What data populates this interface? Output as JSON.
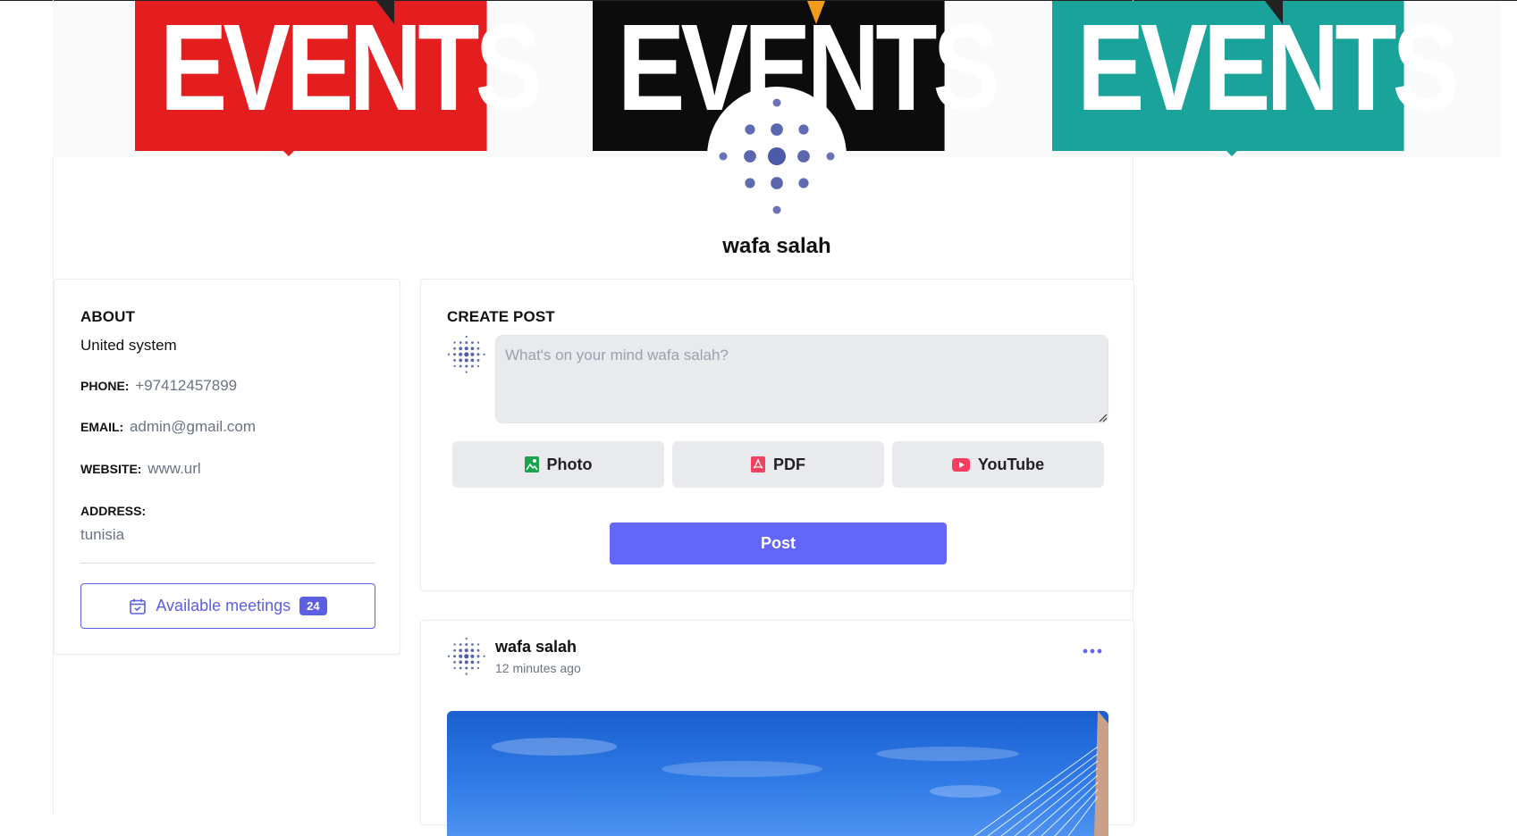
{
  "banner": {
    "words": [
      "EVENTS",
      "EVENTS",
      "EVENTS"
    ],
    "colors": {
      "red": "#e41e1e",
      "black": "#0c0c0c",
      "teal": "#1aa39a"
    }
  },
  "profile": {
    "name": "wafa salah",
    "avatar_icon": "dotted-circle-avatar-icon"
  },
  "about": {
    "heading": "ABOUT",
    "description": "United system",
    "phone_label": "PHONE:",
    "phone": "+97412457899",
    "email_label": "EMAIL:",
    "email": "admin@gmail.com",
    "website_label": "WEBSITE:",
    "website": "www.url",
    "address_label": "ADDRESS:",
    "address": "tunisia",
    "meetings_label": "Available meetings",
    "meetings_count": "24"
  },
  "create_post": {
    "heading": "CREATE POST",
    "placeholder": "What's on your mind wafa salah?",
    "photo_label": "Photo",
    "pdf_label": "PDF",
    "youtube_label": "YouTube",
    "submit_label": "Post"
  },
  "post": {
    "author": "wafa salah",
    "time": "12 minutes ago"
  },
  "colors": {
    "accent": "#6366f6",
    "accent_border": "#5b5fe0",
    "photo_icon": "#16a34a",
    "pdf_icon": "#f43f5e",
    "youtube_icon": "#f43f5e",
    "avatar_dots": "#4c5aa8"
  }
}
